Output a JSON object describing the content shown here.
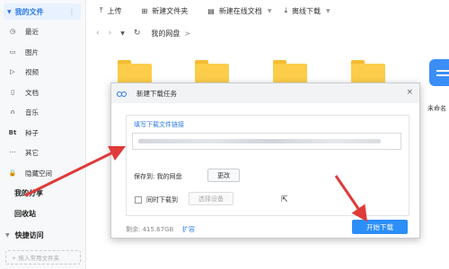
{
  "sidebar": {
    "top_label": "我的文件",
    "more_icon": "more-vertical-icon",
    "items": [
      {
        "icon": "clock-icon",
        "glyph": "◷",
        "label": "最近"
      },
      {
        "icon": "image-icon",
        "glyph": "▭",
        "label": "图片"
      },
      {
        "icon": "video-icon",
        "glyph": "▷",
        "label": "视频"
      },
      {
        "icon": "document-icon",
        "glyph": "▯",
        "label": "文档"
      },
      {
        "icon": "headphone-icon",
        "glyph": "∩",
        "label": "音乐"
      },
      {
        "icon": "bt-icon",
        "glyph": "Bt",
        "label": "种子"
      },
      {
        "icon": "more-icon",
        "glyph": "···",
        "label": "其它"
      },
      {
        "icon": "lock-icon",
        "glyph": "🔒",
        "label": "隐藏空间"
      }
    ],
    "my_share": "我的分享",
    "recycle": "回收站",
    "quick_access": "快捷访问",
    "drag_hint": "+ 拖入常用文件夹"
  },
  "toolbar": {
    "upload": "上传",
    "new_folder": "新建文件夹",
    "new_online_doc": "新建在线文档",
    "offline_download": "离线下载"
  },
  "nav": {
    "crumb": "我的网盘",
    "crumb_arrow": ">"
  },
  "files": {
    "app_label": "未命名"
  },
  "dialog": {
    "title": "新建下载任务",
    "close": "×",
    "link_label": "填写下载文件链接",
    "save_to_label": "保存到: 我的网盘",
    "change_button": "更改",
    "sync_label": "同时下载到",
    "device_button": "选择设备",
    "remaining": "剩余: 415.67GB",
    "expand": "扩容",
    "start_button": "开始下载"
  },
  "colors": {
    "accent": "#2c7be5",
    "folder": "#fccd4a",
    "annotation_arrow": "#e03a3a"
  }
}
